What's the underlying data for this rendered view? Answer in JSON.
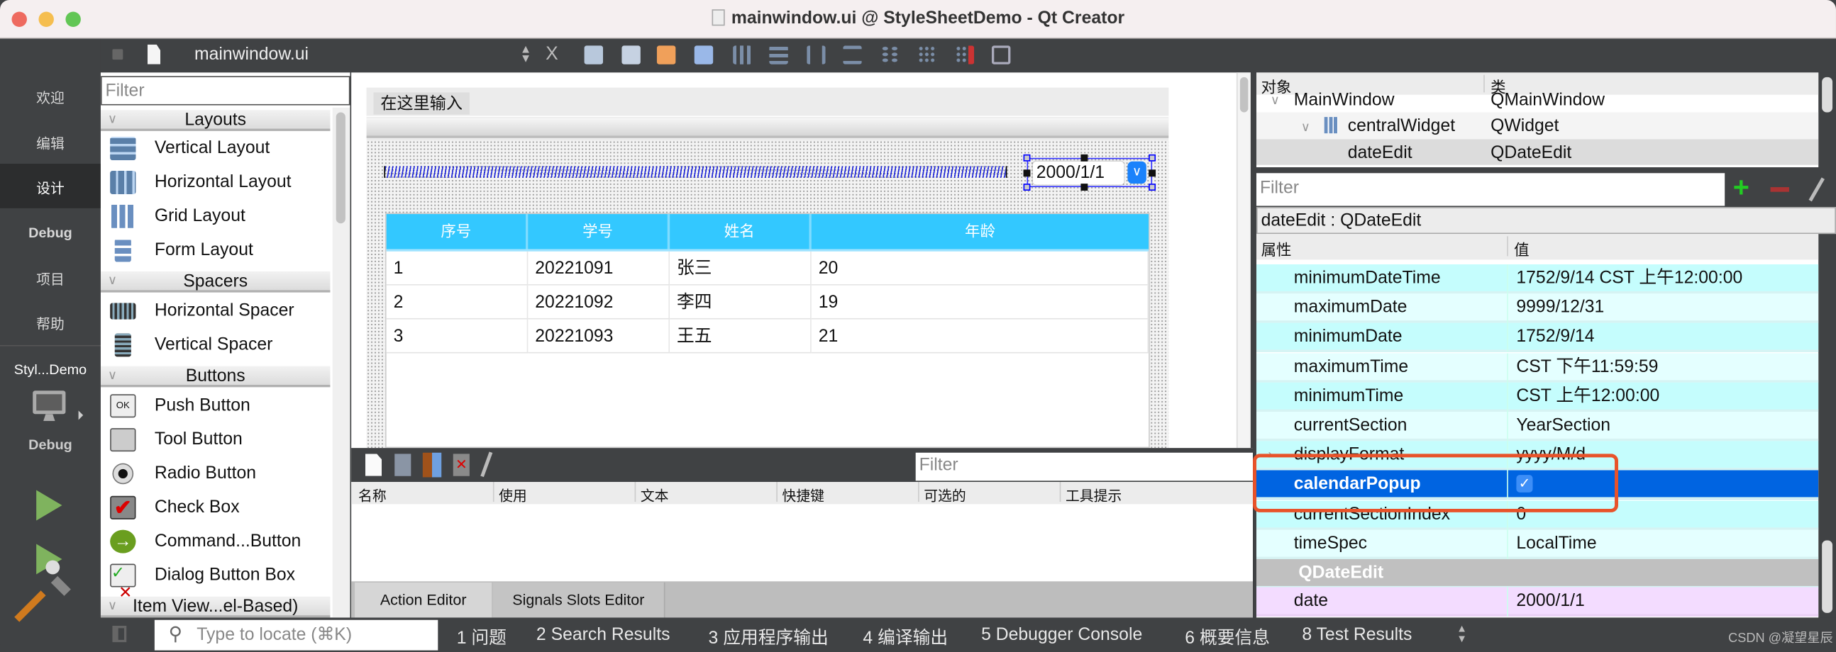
{
  "window": {
    "title": "mainwindow.ui @ StyleSheetDemo - Qt Creator"
  },
  "modebar": {
    "items": [
      "欢迎",
      "编辑",
      "设计",
      "Debug",
      "项目",
      "帮助"
    ],
    "selected": "设计",
    "project": "Styl...Demo",
    "build_config": "Debug"
  },
  "toolbar": {
    "file": "mainwindow.ui",
    "close": "X"
  },
  "widgetbox": {
    "filter_placeholder": "Filter",
    "categories": [
      {
        "name": "Layouts",
        "items": [
          "Vertical Layout",
          "Horizontal Layout",
          "Grid Layout",
          "Form Layout"
        ]
      },
      {
        "name": "Spacers",
        "items": [
          "Horizontal Spacer",
          "Vertical Spacer"
        ]
      },
      {
        "name": "Buttons",
        "items": [
          "Push Button",
          "Tool Button",
          "Radio Button",
          "Check Box",
          "Command...Button",
          "Dialog Button Box"
        ]
      },
      {
        "name": "Item View...el-Based)",
        "items": []
      }
    ]
  },
  "form": {
    "menu_placeholder": "在这里输入",
    "date_value": "2000/1/1",
    "table": {
      "headers": [
        "序号",
        "学号",
        "姓名",
        "年龄"
      ],
      "rows": [
        [
          "1",
          "20221091",
          "张三",
          "20"
        ],
        [
          "2",
          "20221092",
          "李四",
          "19"
        ],
        [
          "3",
          "20221093",
          "王五",
          "21"
        ]
      ]
    },
    "header_color": "#33c8ff"
  },
  "action_editor": {
    "filter_placeholder": "Filter",
    "columns": [
      "名称",
      "使用",
      "文本",
      "快捷键",
      "可选的",
      "工具提示"
    ],
    "tabs": [
      "Action Editor",
      "Signals  Slots Editor"
    ],
    "active_tab": "Action Editor"
  },
  "object_inspector": {
    "headers": [
      "对象",
      "类"
    ],
    "rows": [
      {
        "object": "MainWindow",
        "class": "QMainWindow"
      },
      {
        "object": "centralWidget",
        "class": "QWidget"
      },
      {
        "object": "dateEdit",
        "class": "QDateEdit",
        "selected": true
      }
    ]
  },
  "property_editor": {
    "filter_placeholder": "Filter",
    "subject": "dateEdit : QDateEdit",
    "headers": [
      "属性",
      "值"
    ],
    "rows": [
      {
        "name": "minimumDateTime",
        "value": "1752/9/14 CST 上午12:00:00"
      },
      {
        "name": "maximumDate",
        "value": "9999/12/31"
      },
      {
        "name": "minimumDate",
        "value": "1752/9/14"
      },
      {
        "name": "maximumTime",
        "value": "CST 下午11:59:59"
      },
      {
        "name": "minimumTime",
        "value": "CST 上午12:00:00"
      },
      {
        "name": "currentSection",
        "value": "YearSection"
      },
      {
        "name": "displayFormat",
        "value": "yyyy/M/d"
      },
      {
        "name": "calendarPopup",
        "value": "",
        "checked": true,
        "selected": true
      },
      {
        "name": "currentSectionIndex",
        "value": "0"
      },
      {
        "name": "timeSpec",
        "value": "LocalTime"
      }
    ],
    "section": "QDateEdit",
    "section_rows": [
      {
        "name": "date",
        "value": "2000/1/1"
      }
    ],
    "highlight_color": "#e8532a",
    "selected_color": "#0064e1"
  },
  "statusbar": {
    "locate_placeholder": "Type to locate (⌘K)",
    "items": [
      "1  问题",
      "2  Search Results",
      "3  应用程序输出",
      "4  编译输出",
      "5  Debugger Console",
      "6  概要信息",
      "8  Test Results"
    ],
    "watermark": "CSDN @凝望星辰"
  }
}
